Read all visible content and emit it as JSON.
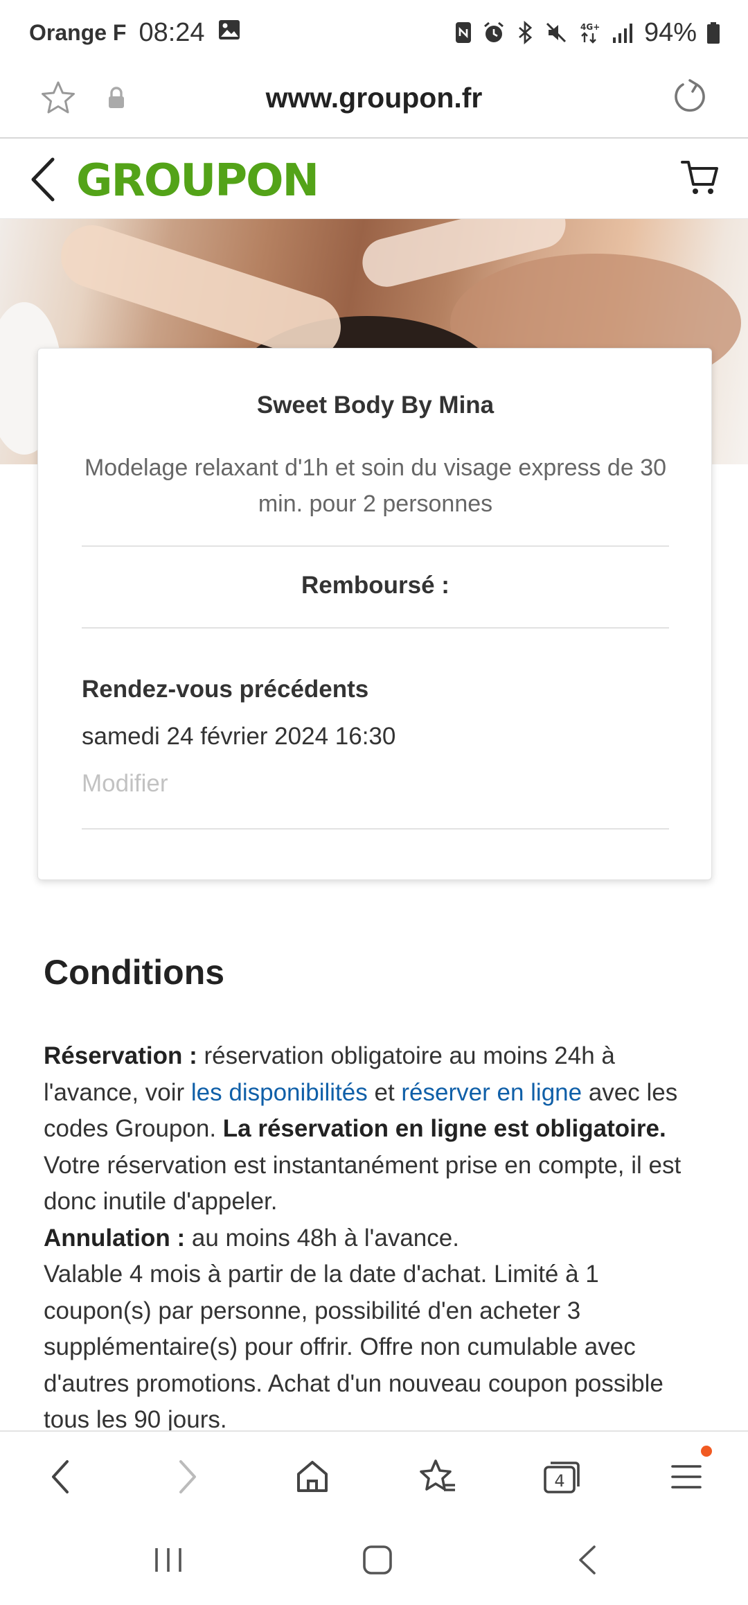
{
  "status_bar": {
    "carrier": "Orange F",
    "time": "08:24",
    "battery": "94%",
    "icons": [
      "gallery-icon",
      "nfc-icon",
      "alarm-icon",
      "bluetooth-icon",
      "mute-icon",
      "4g-icon",
      "signal-icon",
      "battery-icon"
    ]
  },
  "browser": {
    "url": "www.groupon.fr",
    "tab_count": "4"
  },
  "header": {
    "logo": "GROUPON"
  },
  "card": {
    "merchant": "Sweet Body By Mina",
    "description": "Modelage relaxant d'1h et soin du visage express de 30 min. pour 2 personnes",
    "refund_label": "Remboursé :",
    "previous_title": "Rendez-vous précédents",
    "previous_date": "samedi 24 février 2024 16:30",
    "modify_label": "Modifier"
  },
  "conditions": {
    "title": "Conditions",
    "reservation_label": "Réservation :",
    "reservation_text1": " réservation obligatoire au moins 24h à l'avance, voir ",
    "link_availability": "les disponibilités",
    "reservation_text2": " et ",
    "link_book_online": "réserver en ligne",
    "reservation_text3": " avec les codes Groupon. ",
    "online_required": "La réservation en ligne est obligatoire.",
    "instant_text": " Votre réservation est instantanément prise en compte, il est donc inutile d'appeler.",
    "cancel_label": "Annulation :",
    "cancel_text": " au moins 48h à l'avance.",
    "validity_text": "Valable 4 mois à partir de la date d'achat. Limité à 1 coupon(s) par personne, possibilité d'en acheter 3 supplémentaire(s) pour offrir. Offre non cumulable avec d'autres promotions. Achat d'un nouveau coupon possible tous les 90 jours."
  },
  "colors": {
    "brand_green": "#53a318",
    "link_blue": "#0f5fa8",
    "notification_orange": "#f15a22"
  }
}
